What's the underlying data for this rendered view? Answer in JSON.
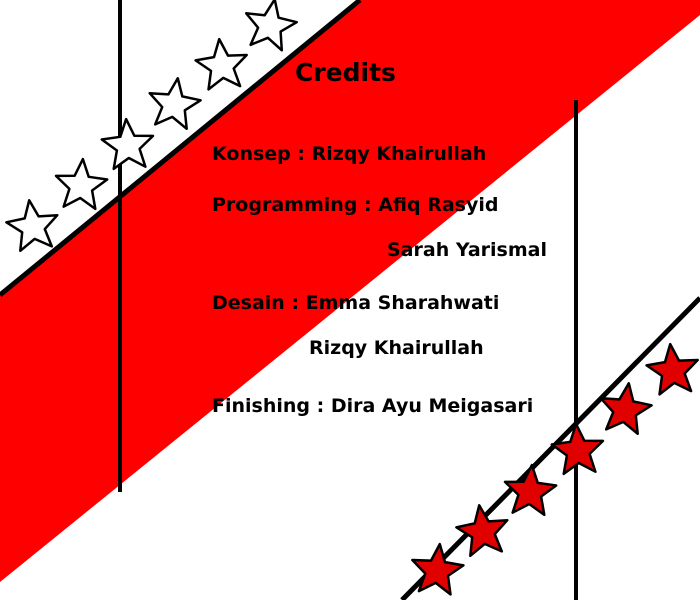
{
  "screen": {
    "title": "Credits",
    "credits": [
      {
        "line": "Konsep : Rizqy Khairullah"
      },
      {
        "line": "Programming : Afiq Rasyid"
      },
      {
        "line": "Sarah Yarismal"
      },
      {
        "line": "Desain : Emma Sharahwati"
      },
      {
        "line": "Rizqy Khairullah"
      },
      {
        "line": "Finishing : Dira Ayu Meigasari"
      }
    ]
  },
  "colors": {
    "background": "#ffffff",
    "stripe": "#ff0000",
    "outline": "#000000",
    "star_top": "#ffffff",
    "star_bottom": "#e00000"
  },
  "decor": {
    "top_stars": "white-star-icon",
    "bottom_stars": "red-star-icon"
  }
}
